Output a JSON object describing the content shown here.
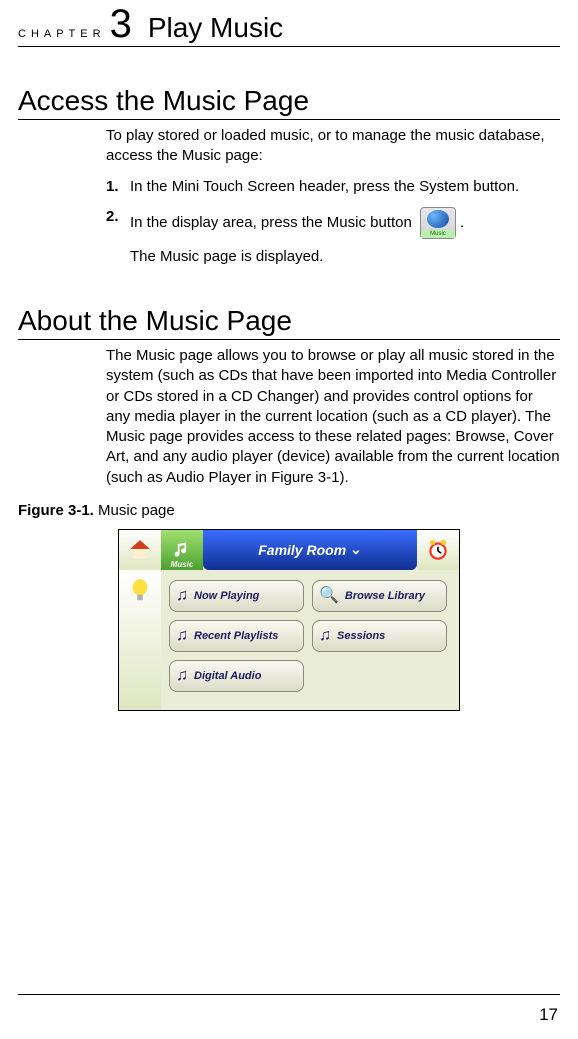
{
  "chapter": {
    "label": "CHAPTER",
    "number": "3",
    "title": "Play Music"
  },
  "section1": {
    "heading": "Access the Music Page",
    "intro": "To play stored or loaded music, or to manage the music database, access the Music page:",
    "steps": [
      {
        "num": "1.",
        "text": "In the Mini Touch Screen header, press the System button."
      },
      {
        "num": "2.",
        "text_before": "In the display area, press the Music button",
        "text_after": ".",
        "button_label": "Music",
        "followup": "The Music page is displayed."
      }
    ]
  },
  "section2": {
    "heading": "About the Music Page",
    "para": "The Music page allows you to browse or play all music stored in the system (such as CDs that have been imported into Media Controller or CDs stored in a CD Changer) and provides control options for any media player in the current location (such as a CD player). The Music page provides access to these related pages: Browse, Cover Art, and any audio player (device) available from the current location (such as Audio Player in Figure 3-1)."
  },
  "figure": {
    "caption_bold": "Figure 3-1.",
    "caption_rest": " Music page",
    "header": {
      "music_label": "Music",
      "room": "Family Room"
    },
    "buttons": {
      "now_playing": "Now Playing",
      "browse_library": "Browse Library",
      "recent_playlists": "Recent Playlists",
      "sessions": "Sessions",
      "digital_audio": "Digital Audio"
    }
  },
  "page_number": "17"
}
